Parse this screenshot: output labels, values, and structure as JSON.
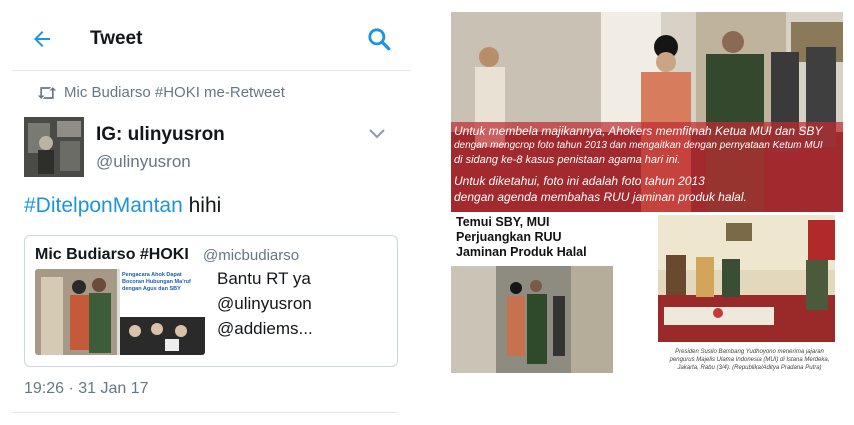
{
  "header": {
    "title": "Tweet"
  },
  "retweet": {
    "text": "Mic Budiarso #HOKI me-Retweet"
  },
  "tweet": {
    "display_name": "IG: ulinyusron",
    "handle": "@ulinyusron",
    "hashtag": "#DitelponMantan",
    "text_rest": " hihi",
    "timestamp": "19:26 · 31 Jan 17"
  },
  "quote": {
    "display_name": "Mic Budiarso #HOKI",
    "handle": "@micbudiarso",
    "text_lines": [
      "Bantu RT ya",
      "@ulinyusron",
      "@addiems..."
    ],
    "thumb_headline": "Pengacara Ahok Dapat Bocoran Hubungan Ma'ruf dengan Agus dan SBY"
  },
  "image": {
    "overlay_lines": [
      "Untuk membela majikannya, Ahokers memfitnah Ketua MUI dan SBY",
      "dengan mengcrop foto tahun 2013 dan mengaitkan dengan pernyataan Ketum MUI",
      "di sidang ke-8 kasus penistaan agama hari ini.",
      "Untuk diketahui, foto ini adalah foto tahun 2013",
      "dengan agenda membahas RUU jaminan produk halal."
    ],
    "article_title_lines": [
      "Temui SBY, MUI",
      "Perjuangkan RUU",
      "Jaminan Produk Halal"
    ],
    "photo_caption": "Presiden Susilo Bambang Yudhoyono menerima jajaran pengurus Majelis Ulama Indonesia (MUI) di Istana Merdeka, Jakarta, Rabu (3/4). (Republika/Aditya Pradana Putra)"
  },
  "colors": {
    "link": "#1b95e0",
    "secondary_text": "#657786",
    "overlay": "#be2d32"
  }
}
